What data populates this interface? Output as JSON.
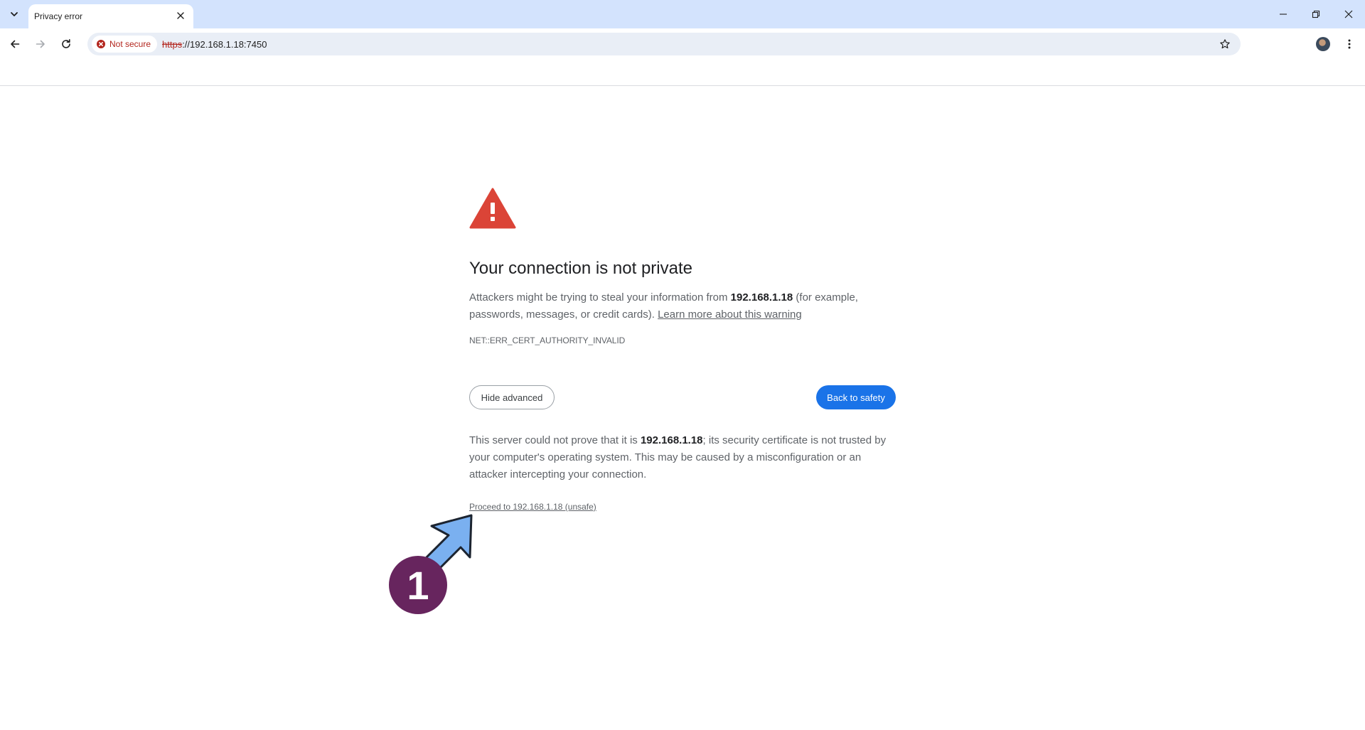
{
  "browser": {
    "tab": {
      "title": "Privacy error"
    },
    "omnibox": {
      "security_label": "Not secure",
      "url_scheme": "https",
      "url_rest": "://192.168.1.18:7450"
    }
  },
  "icons": {
    "tab_search": "chevron-down-icon",
    "tab_close": "close-icon",
    "back": "arrow-left-icon",
    "forward": "arrow-right-icon",
    "reload": "reload-icon",
    "security": "error-circle-icon",
    "bookmark": "star-icon",
    "menu": "kebab-menu-icon",
    "warning": "warning-triangle-icon"
  },
  "interstitial": {
    "heading": "Your connection is not private",
    "intro_pre": "Attackers might be trying to steal your information from ",
    "host": "192.168.1.18",
    "intro_post": " (for example, passwords, messages, or credit cards). ",
    "learn_more": "Learn more about this warning",
    "error_code": "NET::ERR_CERT_AUTHORITY_INVALID",
    "hide_advanced": "Hide advanced",
    "back_to_safety": "Back to safety",
    "details_pre": "This server could not prove that it is ",
    "details_host": "192.168.1.18",
    "details_post": "; its security certificate is not trusted by your computer's operating system. This may be caused by a misconfiguration or an attacker intercepting your connection.",
    "proceed_link": "Proceed to 192.168.1.18 (unsafe)"
  },
  "annotation": {
    "step_number": "1"
  },
  "colors": {
    "tabstrip_bg": "#d3e3fd",
    "danger_red": "#db4437",
    "primary_blue": "#1a73e8",
    "annotation_purple": "#67255e",
    "annotation_arrow": "#7ab0f0"
  }
}
